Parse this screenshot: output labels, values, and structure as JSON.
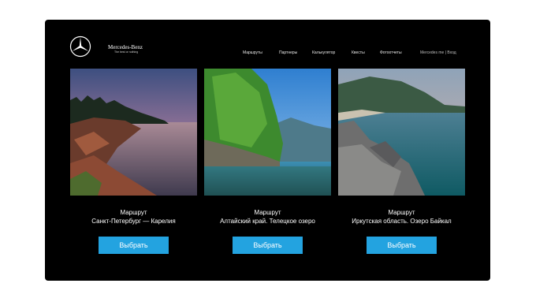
{
  "brand": {
    "name": "Mercedes-Benz",
    "tagline": "The best or nothing"
  },
  "nav": {
    "items": [
      "Маршруты",
      "Партнеры",
      "Калькулятор",
      "Квесты",
      "Фотоотчеты"
    ],
    "account": {
      "link": "Mercedes me",
      "separator": "|",
      "login": "Вход"
    }
  },
  "cards": [
    {
      "title": "Маршрут",
      "subtitle": "Санкт-Петербург — Карелия",
      "button": "Выбрать"
    },
    {
      "title": "Маршрут",
      "subtitle": "Алтайский край. Телецкое озеро",
      "button": "Выбрать"
    },
    {
      "title": "Маршрут",
      "subtitle": "Иркутская область. Озеро Байкал",
      "button": "Выбрать"
    }
  ],
  "colors": {
    "background": "#000000",
    "button": "#23a3e0",
    "text": "#ffffff"
  },
  "icons": {
    "logo": "mercedes-star-icon"
  }
}
